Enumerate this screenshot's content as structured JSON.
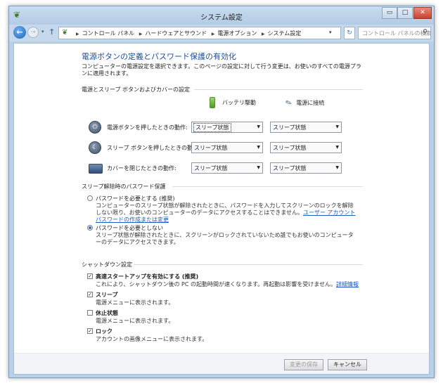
{
  "window": {
    "title": "システム設定",
    "app_icon": "control-panel-icon",
    "buttons": {
      "minimize": "▭",
      "maximize": "□",
      "close": "✕"
    }
  },
  "nav": {
    "back": "←",
    "forward": "→",
    "up": "↑",
    "breadcrumbs": [
      "コントロール パネル",
      "ハードウェアとサウンド",
      "電源オプション",
      "システム設定"
    ],
    "dropdown_arrow": "▾",
    "refresh": "↻",
    "search_placeholder": "コントロール パネルの検索",
    "search_icon": "⚲"
  },
  "page": {
    "heading": "電源ボタンの定義とパスワード保護の有効化",
    "intro": "コンピューターの電源設定を選択できます。このページの設定に対して行う変更は、お使いのすべての電源プランに適用されます。"
  },
  "power_section": {
    "title": "電源とスリープ ボタンおよびカバーの設定",
    "col_battery": "バッテリ駆動",
    "col_plugged": "電源に接続",
    "rows": [
      {
        "label": "電源ボタンを押したときの動作:",
        "battery": "スリープ状態",
        "plugged": "スリープ状態"
      },
      {
        "label": "スリープ ボタンを押したときの動作:",
        "battery": "スリープ状態",
        "plugged": "スリープ状態"
      },
      {
        "label": "カバーを閉じたときの動作:",
        "battery": "スリープ状態",
        "plugged": "スリープ状態"
      }
    ]
  },
  "password_section": {
    "title": "スリープ解除時のパスワード保護",
    "require": {
      "label": "パスワードを必要とする (推奨)",
      "desc": "コンピューターのスリープ状態が解除されたときに、パスワードを入力してスクリーンのロックを解除しない限り、お使いのコンピューターのデータにアクセスすることはできません。",
      "link": "ユーザー アカウント パスワードの作成または変更",
      "selected": false
    },
    "no_require": {
      "label": "パスワードを必要としない",
      "desc": "スリープ状態が解除されたときに、スクリーンがロックされていないため誰でもお使いのコンピューターのデータにアクセスできます。",
      "selected": true
    }
  },
  "shutdown_section": {
    "title": "シャットダウン設定",
    "options": [
      {
        "label": "高速スタートアップを有効にする (推奨)",
        "desc": "これにより、シャットダウン後の PC の起動時間が速くなります。再起動は影響を受けません。",
        "link": "詳細情報",
        "checked": true
      },
      {
        "label": "スリープ",
        "desc": "電源メニューに表示されます。",
        "checked": true
      },
      {
        "label": "休止状態",
        "desc": "電源メニューに表示されます。",
        "checked": false
      },
      {
        "label": "ロック",
        "desc": "アカウントの画像メニューに表示されます。",
        "checked": true
      }
    ]
  },
  "footer": {
    "save": "変更の保存",
    "cancel": "キャンセル"
  }
}
